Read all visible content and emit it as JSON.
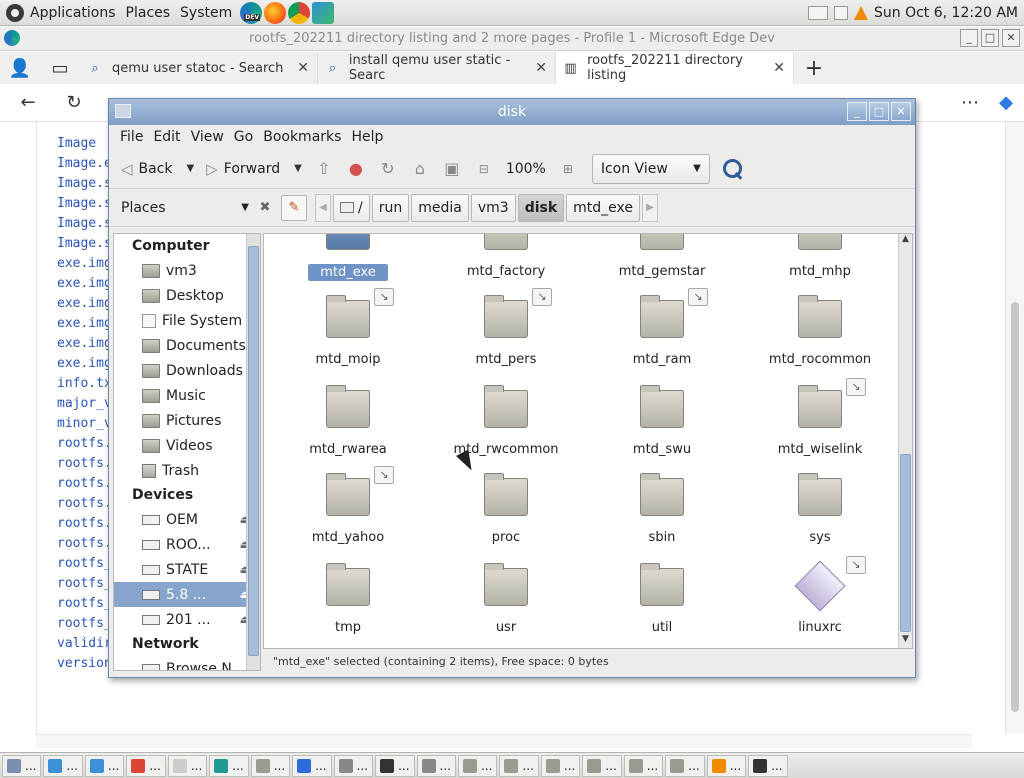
{
  "top_panel": {
    "menu": [
      "Applications",
      "Places",
      "System"
    ],
    "launcher_badge": "DEV",
    "clock": "Sun Oct  6, 12:20 AM"
  },
  "browser": {
    "window_title": "rootfs_202211 directory listing and 2 more pages - Profile 1 - Microsoft Edge Dev",
    "tabs": [
      {
        "label": "qemu user statoc - Search",
        "icon": "search-icon"
      },
      {
        "label": "install qemu user static - Searc",
        "icon": "search-icon"
      },
      {
        "label": "rootfs_202211 directory listing",
        "icon": "archive-icon"
      }
    ],
    "page_files": [
      "Image",
      "Image.e",
      "Image.s",
      "Image.s",
      "Image.s",
      "Image.s",
      "exe.img",
      "exe.img",
      "exe.img",
      "exe.img",
      "exe.img",
      "exe.img",
      "info.tx",
      "major_v",
      "minor_v",
      "rootfs.",
      "rootfs.",
      "rootfs.",
      "rootfs.",
      "rootfs.",
      "rootfs.",
      "rootfs_",
      "rootfs_",
      "rootfs_",
      "rootfs_",
      "validir",
      "version"
    ]
  },
  "nautilus": {
    "title": "disk",
    "menu": [
      "File",
      "Edit",
      "View",
      "Go",
      "Bookmarks",
      "Help"
    ],
    "toolbar": {
      "back": "Back",
      "forward": "Forward",
      "zoom": "100%",
      "view_mode": "Icon View"
    },
    "places_label": "Places",
    "breadcrumbs": [
      "/",
      "run",
      "media",
      "vm3",
      "disk",
      "mtd_exe"
    ],
    "current_crumb": "disk",
    "sidebar": {
      "computer_heading": "Computer",
      "computer_items": [
        "vm3",
        "Desktop",
        "File System",
        "Documents",
        "Downloads",
        "Music",
        "Pictures",
        "Videos",
        "Trash"
      ],
      "devices_heading": "Devices",
      "device_items": [
        "OEM",
        "ROO...",
        "STATE",
        "5.8 ...",
        "201 ..."
      ],
      "selected_device": "5.8 ...",
      "network_heading": "Network",
      "network_items": [
        "Browse N..."
      ]
    },
    "files": [
      {
        "name": "mtd_exe",
        "link": false,
        "selected": true
      },
      {
        "name": "mtd_factory",
        "link": false,
        "selected": false
      },
      {
        "name": "mtd_gemstar",
        "link": false,
        "selected": false
      },
      {
        "name": "mtd_mhp",
        "link": false,
        "selected": false
      },
      {
        "name": "mtd_moip",
        "link": true,
        "selected": false
      },
      {
        "name": "mtd_pers",
        "link": true,
        "selected": false
      },
      {
        "name": "mtd_ram",
        "link": true,
        "selected": false
      },
      {
        "name": "mtd_rocommon",
        "link": false,
        "selected": false
      },
      {
        "name": "mtd_rwarea",
        "link": false,
        "selected": false
      },
      {
        "name": "mtd_rwcommon",
        "link": false,
        "selected": false
      },
      {
        "name": "mtd_swu",
        "link": false,
        "selected": false
      },
      {
        "name": "mtd_wiselink",
        "link": true,
        "selected": false
      },
      {
        "name": "mtd_yahoo",
        "link": true,
        "selected": false
      },
      {
        "name": "proc",
        "link": false,
        "selected": false
      },
      {
        "name": "sbin",
        "link": false,
        "selected": false
      },
      {
        "name": "sys",
        "link": false,
        "selected": false
      },
      {
        "name": "tmp",
        "link": false,
        "selected": false
      },
      {
        "name": "usr",
        "link": false,
        "selected": false
      },
      {
        "name": "util",
        "link": false,
        "selected": false
      },
      {
        "name": "linuxrc",
        "link": true,
        "selected": false,
        "type": "script"
      }
    ],
    "status": "\"mtd_exe\" selected (containing 2 items), Free space: 0 bytes"
  },
  "taskbar": {
    "tasks": [
      "...",
      "...",
      "...",
      "...",
      "...",
      "...",
      "...",
      "...",
      "...",
      "...",
      "...",
      "...",
      "...",
      "...",
      "...",
      "...",
      "...",
      "...",
      "..."
    ]
  }
}
